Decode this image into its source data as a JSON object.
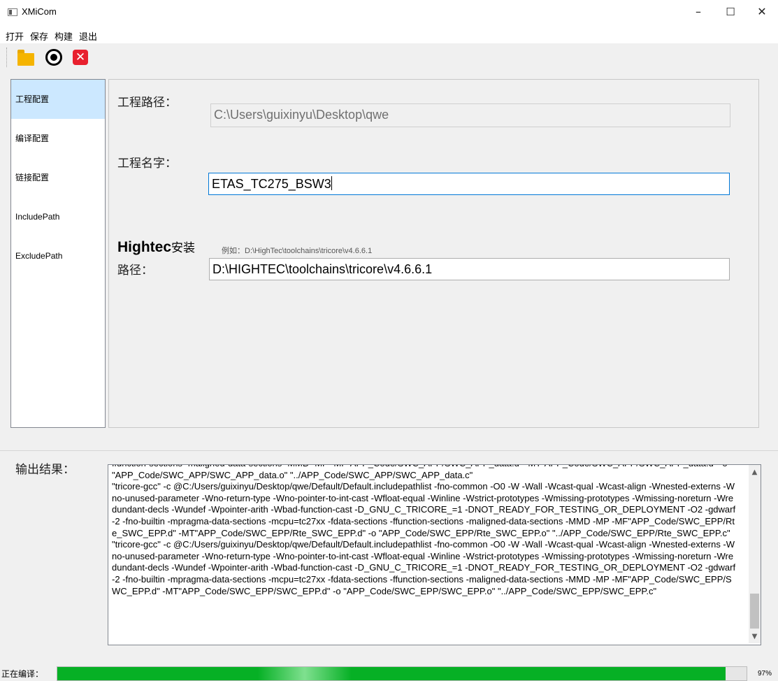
{
  "window": {
    "title": "XMiCom",
    "minimize_glyph": "–",
    "maximize_glyph": "☐",
    "close_glyph": "✕"
  },
  "menu": [
    "打开",
    "保存",
    "构建",
    "退出"
  ],
  "toolbar": {
    "icons": [
      "folder-icon",
      "stop-icon",
      "close-red-icon"
    ],
    "close_glyph": "✕"
  },
  "sidebar": {
    "items": [
      {
        "label": "工程配置",
        "active": true
      },
      {
        "label": "编译配置",
        "active": false
      },
      {
        "label": "链接配置",
        "active": false
      },
      {
        "label": "IncludePath",
        "active": false
      },
      {
        "label": "ExcludePath",
        "active": false
      }
    ]
  },
  "project": {
    "path_label": "工程路径：",
    "path_value": "C:\\Users\\guixinyu\\Desktop\\qwe",
    "name_label": "工程名字：",
    "name_value": "ETAS_TC275_BSW3",
    "hightec_bold": "Hightec",
    "hightec_cn": "安装",
    "hightec_label2": "路径：",
    "hightec_example": "例如：D:\\HighTec\\toolchains\\tricore\\v4.6.6.1",
    "hightec_value": "D:\\HIGHTEC\\toolchains\\tricore\\v4.6.6.1"
  },
  "output": {
    "label": "输出结果：",
    "text": "ffunction-sections -maligned-data-sections -MMD -MP -MF\"APP_Code/SWC_APP/SWC_APP_data.d\" -MT\"APP_Code/SWC_APP/SWC_APP_data.d\" -o \"APP_Code/SWC_APP/SWC_APP_data.o\" \"../APP_Code/SWC_APP/SWC_APP_data.c\"\n\"tricore-gcc\" -c @C:/Users/guixinyu/Desktop/qwe/Default/Default.includepathlist -fno-common -O0 -W -Wall -Wcast-qual -Wcast-align -Wnested-externs -Wno-unused-parameter -Wno-return-type -Wno-pointer-to-int-cast -Wfloat-equal -Winline -Wstrict-prototypes -Wmissing-prototypes -Wmissing-noreturn -Wredundant-decls -Wundef -Wpointer-arith -Wbad-function-cast -D_GNU_C_TRICORE_=1 -DNOT_READY_FOR_TESTING_OR_DEPLOYMENT -O2 -gdwarf-2 -fno-builtin -mpragma-data-sections -mcpu=tc27xx -fdata-sections -ffunction-sections -maligned-data-sections -MMD -MP -MF\"APP_Code/SWC_EPP/Rte_SWC_EPP.d\" -MT\"APP_Code/SWC_EPP/Rte_SWC_EPP.d\" -o \"APP_Code/SWC_EPP/Rte_SWC_EPP.o\" \"../APP_Code/SWC_EPP/Rte_SWC_EPP.c\"\n\"tricore-gcc\" -c @C:/Users/guixinyu/Desktop/qwe/Default/Default.includepathlist -fno-common -O0 -W -Wall -Wcast-qual -Wcast-align -Wnested-externs -Wno-unused-parameter -Wno-return-type -Wno-pointer-to-int-cast -Wfloat-equal -Winline -Wstrict-prototypes -Wmissing-prototypes -Wmissing-noreturn -Wredundant-decls -Wundef -Wpointer-arith -Wbad-function-cast -D_GNU_C_TRICORE_=1 -DNOT_READY_FOR_TESTING_OR_DEPLOYMENT -O2 -gdwarf-2 -fno-builtin -mpragma-data-sections -mcpu=tc27xx -fdata-sections -ffunction-sections -maligned-data-sections -MMD -MP -MF\"APP_Code/SWC_EPP/SWC_EPP.d\" -MT\"APP_Code/SWC_EPP/SWC_EPP.d\" -o \"APP_Code/SWC_EPP/SWC_EPP.o\" \"../APP_Code/SWC_EPP/SWC_EPP.c\"",
    "scroll_up_glyph": "▲",
    "scroll_down_glyph": "▼"
  },
  "status": {
    "label": "正在编译：",
    "progress_fraction": 0.97,
    "progress_text": "97%",
    "progress_color": "#06b025"
  }
}
